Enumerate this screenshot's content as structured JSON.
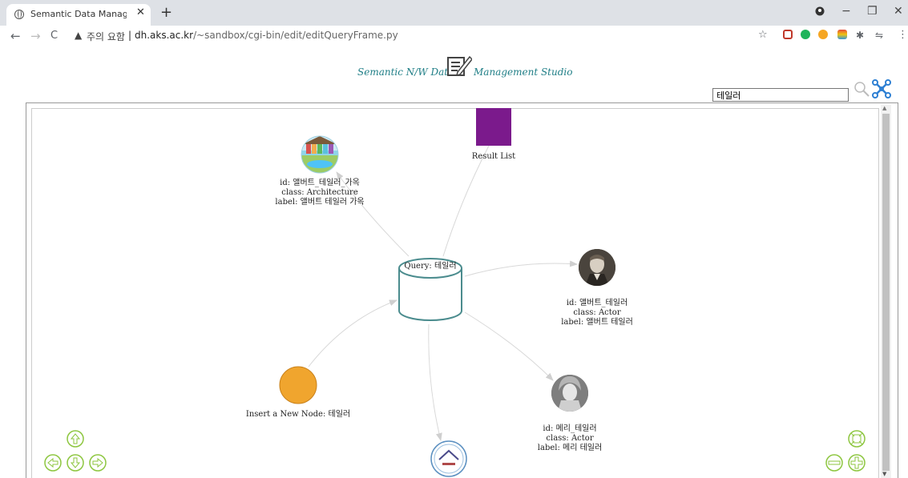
{
  "browser": {
    "tab_title": "Semantic Data Management St",
    "tab_close": "✕",
    "new_tab": "+",
    "warning": "주의 요함",
    "url_host": "dh.aks.ac.kr",
    "url_path": "/~sandbox/cgi-bin/edit/editQueryFrame.py",
    "nav_back": "←",
    "nav_forward": "→",
    "nav_reload": "C",
    "win_minimize": "−",
    "win_maximize": "❐",
    "win_close": "✕"
  },
  "header": {
    "title_left": "Semantic N/W Data",
    "title_right": "Management Studio"
  },
  "search": {
    "value": "테일러"
  },
  "graph": {
    "query_node": "Query: 테일러",
    "result_node": "Result List",
    "insert_node": "Insert a New Node: 테일러",
    "architecture": {
      "id": "id: 앨버트_테일러_가옥",
      "class": "class: Architecture",
      "label": "label: 앨버트 테일러 가옥"
    },
    "actor1": {
      "id": "id: 앨버트_테일러",
      "class": "class: Actor",
      "label": "label: 앨버트 테일러"
    },
    "actor2": {
      "id": "id: 메리_테일러",
      "class": "class: Actor",
      "label": "label: 메리 테일러"
    }
  },
  "colors": {
    "accent": "#1f7e86",
    "control_green": "#8dc63f",
    "result_node": "#7b1a8c",
    "insert_node": "#f0a52e"
  },
  "controls": [
    "pan-up",
    "pan-left",
    "pan-down",
    "pan-right",
    "fit-to-screen",
    "zoom-out",
    "zoom-in"
  ]
}
